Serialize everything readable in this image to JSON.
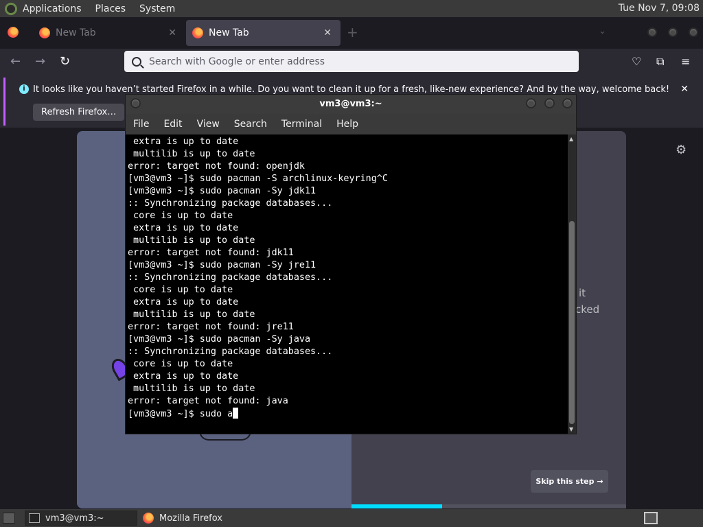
{
  "top_panel": {
    "menus": [
      "Applications",
      "Places",
      "System"
    ],
    "clock": "Tue Nov 7, 09:08"
  },
  "firefox": {
    "tabs": [
      {
        "label": "New Tab",
        "active": false
      },
      {
        "label": "New Tab",
        "active": true
      }
    ],
    "tab_close": "✕",
    "new_tab": "+",
    "tab_list": "⌄",
    "nav": {
      "back": "←",
      "forward": "→",
      "reload": "↻"
    },
    "url_placeholder": "Search with Google or enter address",
    "toolbar_icons": [
      "pocket-icon",
      "extensions-icon",
      "menu-icon"
    ],
    "toolbar_glyphs": {
      "pocket": "♡",
      "extensions": "⧉",
      "menu": "≡"
    },
    "notification": {
      "message": "It looks like you haven’t started Firefox in a while. Do you want to clean it up for a fresh, like-new experience? And by the way, welcome back!",
      "button": "Refresh Firefox…",
      "close": "✕"
    },
    "page": {
      "fragment_1": "it",
      "fragment_2": "cked",
      "skip": "Skip this step →",
      "settings_glyph": "⚙",
      "progress": 0.33
    },
    "accent": "#00ddff"
  },
  "terminal": {
    "title": "vm3@vm3:~",
    "menu": [
      "File",
      "Edit",
      "View",
      "Search",
      "Terminal",
      "Help"
    ],
    "lines": [
      " extra is up to date",
      " multilib is up to date",
      "error: target not found: openjdk",
      "[vm3@vm3 ~]$ sudo pacman -S archlinux-keyring^C",
      "[vm3@vm3 ~]$ sudo pacman -Sy jdk11",
      ":: Synchronizing package databases...",
      " core is up to date",
      " extra is up to date",
      " multilib is up to date",
      "error: target not found: jdk11",
      "[vm3@vm3 ~]$ sudo pacman -Sy jre11",
      ":: Synchronizing package databases...",
      " core is up to date",
      " extra is up to date",
      " multilib is up to date",
      "error: target not found: jre11",
      "[vm3@vm3 ~]$ sudo pacman -Sy java",
      ":: Synchronizing package databases...",
      " core is up to date",
      " extra is up to date",
      " multilib is up to date",
      "error: target not found: java"
    ],
    "prompt_line": "[vm3@vm3 ~]$ sudo a"
  },
  "taskbar": {
    "items": [
      {
        "label": "vm3@vm3:~",
        "icon": "terminal-icon"
      },
      {
        "label": "Mozilla Firefox",
        "icon": "firefox-icon"
      }
    ]
  }
}
